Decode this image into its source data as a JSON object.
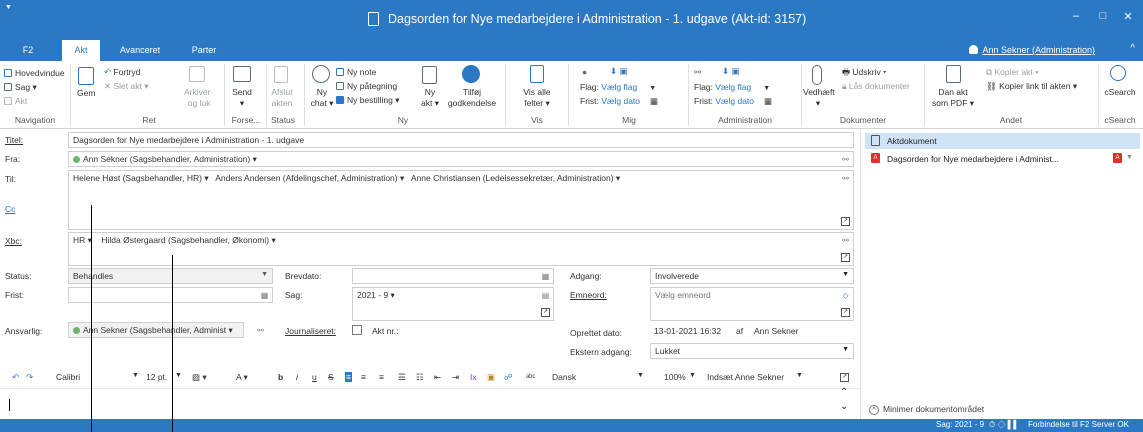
{
  "window": {
    "title": "Dagsorden for Nye medarbejdere i Administration - 1. udgave (Akt-id: 3157)",
    "quick_access": "▼",
    "minimize": "‒",
    "maximize": "□",
    "close": "✕"
  },
  "tabs": [
    "F2",
    "Akt",
    "Avanceret",
    "Parter"
  ],
  "user": "Ann Sekner (Administration)",
  "collapse": "^",
  "ribbon": {
    "navigation": {
      "items": [
        "Hovedvindue",
        "Sag ▾",
        "Akt"
      ],
      "label": "Navigation"
    },
    "ret": {
      "gem": "Gem",
      "fortryd": "Fortryd",
      "slet": "Slet akt ▾",
      "arkiver": "Arkiver",
      "arkiver2": "og luk",
      "label": "Ret"
    },
    "forse": {
      "send": "Send",
      "send2": "▾",
      "label": "Forse..."
    },
    "status": {
      "afslut": "Afslut",
      "afslut2": "akten",
      "label": "Status"
    },
    "ny": {
      "ny_chat": "Ny",
      "ny_chat2": "chat ▾",
      "ny_note": "Ny note",
      "ny_paategning": "Ny påtegning",
      "ny_bestilling": "Ny bestilling ▾",
      "ny_akt": "Ny",
      "ny_akt2": "akt ▾",
      "tilfoej": "Tilføj",
      "tilfoej2": "godkendelse",
      "label": "Ny"
    },
    "vis": {
      "vis_alle": "Vis alle",
      "vis_alle2": "felter ▾",
      "label": "Vis"
    },
    "mig": {
      "flag": "Flag:",
      "flag_val": "Vælg flag",
      "frist": "Frist:",
      "frist_val": "Vælg dato",
      "label": "Mig"
    },
    "administration": {
      "flag": "Flag:",
      "flag_val": "Vælg flag",
      "frist": "Frist:",
      "frist_val": "Vælg dato",
      "label": "Administration"
    },
    "dokumenter": {
      "vedhaeft": "Vedhæft",
      "vedhaeft2": "▾",
      "udskriv": "Udskriv ▾",
      "laas": "Lås dokumenter",
      "label": "Dokumenter"
    },
    "andet": {
      "dan_akt": "Dan akt",
      "dan_akt2": "som PDF ▾",
      "kopier_akt": "Kopier akt ▾",
      "kopier_link": "Kopier link til akten ▾",
      "label": "Andet"
    },
    "csearch": {
      "btn": "cSearch",
      "label": "cSearch"
    }
  },
  "form": {
    "titel_label": "Titel:",
    "titel_value": "Dagsorden for Nye medarbejdere i Administration - 1. udgave",
    "fra_label": "Fra:",
    "fra_value": "Ann Sekner (Sagsbehandler, Administration) ▾",
    "til_label": "Til:",
    "til_recipients": [
      "Helene Høst (Sagsbehandler, HR) ▾",
      "Anders Andersen (Afdelingschef, Administration) ▾",
      "Anne Christiansen (Ledelsessekretær, Administration) ▾"
    ],
    "cc_label": "Cc",
    "xbc_label": "Xbc:",
    "xbc_recipients": [
      "HR ▾",
      "Hilda Østergaard (Sagsbehandler, Økonomi) ▾"
    ],
    "status_label": "Status:",
    "status_value": "Behandles",
    "frist_label": "Frist:",
    "ansvarlig_label": "Ansvarlig:",
    "ansvarlig_value": "Ann Sekner (Sagsbehandler, Administ ▾",
    "brevdato_label": "Brevdato:",
    "sag_label": "Sag:",
    "sag_value": "2021 - 9 ▾",
    "journaliseret_label": "Journaliseret:",
    "akt_nr_label": "Akt nr.:",
    "adgang_label": "Adgang:",
    "adgang_value": "Involverede",
    "emneord_label": "Emneord:",
    "emneord_placeholder": "Vælg emneord",
    "oprettet_label": "Oprettet dato:",
    "oprettet_value": "13-01-2021 16:32",
    "oprettet_af": "af",
    "oprettet_user": "Ann Sekner",
    "ekstern_label": "Ekstern adgang:",
    "ekstern_value": "Lukket"
  },
  "toolbar": {
    "undo": "↶",
    "redo": "↷",
    "font": "Calibri",
    "size": "12 pt.",
    "bold": "b",
    "italic": "i",
    "underline": "u",
    "strike": "S",
    "language": "Dansk",
    "zoom": "100%",
    "insert": "Indsæt Anne Sekner"
  },
  "side": {
    "header": "Aktdokument",
    "document": "Dagsorden for Nye medarbejdere i Administ...",
    "minimize": "Minimer dokumentområdet"
  },
  "statusbar": {
    "sag": "Sag: 2021 - 9",
    "connection": "Forbindelse til F2 Server OK"
  },
  "colors": {
    "accent": "#2b78c5",
    "status_green": "#6fb36f",
    "pdf_red": "#d9342b"
  }
}
